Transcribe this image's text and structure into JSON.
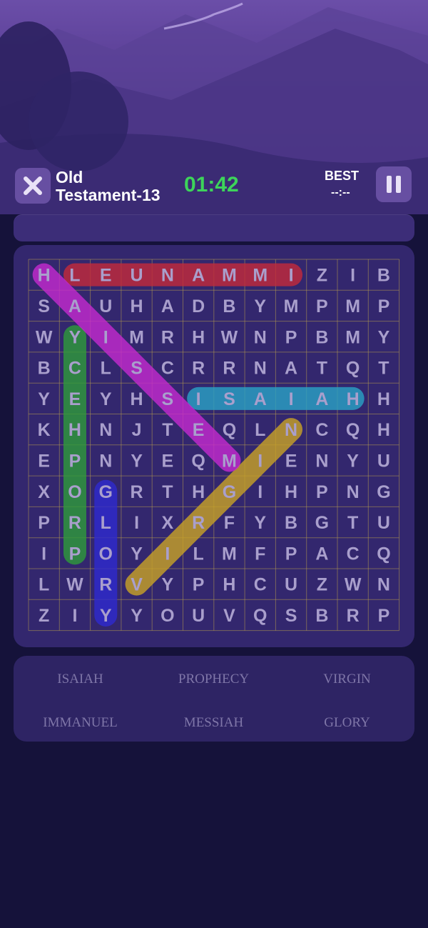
{
  "header": {
    "title_line1": "Old",
    "title_line2": "Testament-13",
    "timer": "01:42",
    "best_label": "BEST",
    "best_value": "--:--"
  },
  "icons": {
    "close": "close-icon",
    "pause": "pause-icon"
  },
  "grid": {
    "rows": [
      [
        "H",
        "L",
        "E",
        "U",
        "N",
        "A",
        "M",
        "M",
        "I",
        "Z",
        "I",
        "B"
      ],
      [
        "S",
        "A",
        "U",
        "H",
        "A",
        "D",
        "B",
        "Y",
        "M",
        "P",
        "M",
        "P"
      ],
      [
        "W",
        "Y",
        "I",
        "M",
        "R",
        "H",
        "W",
        "N",
        "P",
        "B",
        "M",
        "Y"
      ],
      [
        "B",
        "C",
        "L",
        "S",
        "C",
        "R",
        "R",
        "N",
        "A",
        "T",
        "Q",
        "T"
      ],
      [
        "Y",
        "E",
        "Y",
        "H",
        "S",
        "I",
        "S",
        "A",
        "I",
        "A",
        "H",
        "H"
      ],
      [
        "K",
        "H",
        "N",
        "J",
        "T",
        "E",
        "Q",
        "L",
        "N",
        "C",
        "Q",
        "H"
      ],
      [
        "E",
        "P",
        "N",
        "Y",
        "E",
        "Q",
        "M",
        "I",
        "E",
        "N",
        "Y",
        "U"
      ],
      [
        "X",
        "O",
        "G",
        "R",
        "T",
        "H",
        "G",
        "I",
        "H",
        "P",
        "N",
        "G"
      ],
      [
        "P",
        "R",
        "L",
        "I",
        "X",
        "R",
        "F",
        "Y",
        "B",
        "G",
        "T",
        "U"
      ],
      [
        "I",
        "P",
        "O",
        "Y",
        "I",
        "L",
        "M",
        "F",
        "P",
        "A",
        "C",
        "Q"
      ],
      [
        "L",
        "W",
        "R",
        "V",
        "Y",
        "P",
        "H",
        "C",
        "U",
        "Z",
        "W",
        "N"
      ],
      [
        "Z",
        "I",
        "Y",
        "Y",
        "O",
        "U",
        "V",
        "Q",
        "S",
        "B",
        "R",
        "P"
      ]
    ],
    "found": [
      {
        "word": "IMMANUEL",
        "from": [
          0,
          8
        ],
        "to": [
          0,
          1
        ],
        "color": "#c42a3a"
      },
      {
        "word": "ISAIAH",
        "from": [
          4,
          5
        ],
        "to": [
          4,
          10
        ],
        "color": "#2aa3c6"
      },
      {
        "word": "PROPHECY",
        "from": [
          9,
          1
        ],
        "to": [
          2,
          1
        ],
        "color": "#2f9c3a"
      },
      {
        "word": "GLORY",
        "from": [
          7,
          2
        ],
        "to": [
          11,
          2
        ],
        "color": "#2f2ad0"
      },
      {
        "word": "VIRGIN",
        "from": [
          10,
          3
        ],
        "to": [
          5,
          8
        ],
        "color": "#c9a326"
      },
      {
        "word": "MESSIAH",
        "from": [
          6,
          6
        ],
        "to": [
          0,
          0
        ],
        "color": "#c62ad0"
      }
    ]
  },
  "words": [
    "ISAIAH",
    "PROPHECY",
    "VIRGIN",
    "IMMANUEL",
    "MESSIAH",
    "GLORY"
  ]
}
